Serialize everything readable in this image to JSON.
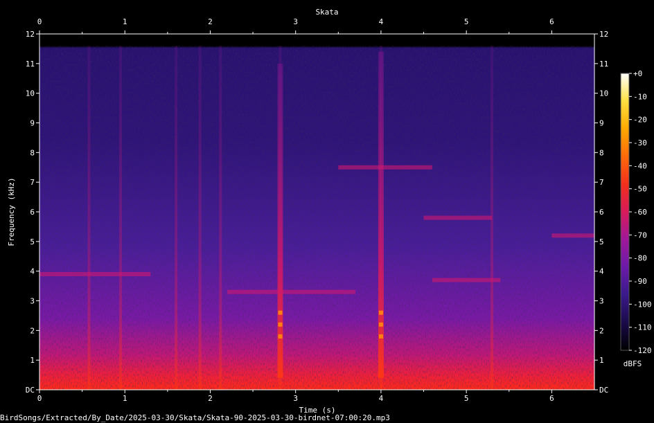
{
  "chart_data": {
    "type": "heatmap",
    "title": "Skata",
    "xlabel": "Time (s)",
    "ylabel": "Frequency (kHz)",
    "xlim": [
      0,
      6.5
    ],
    "ylim": [
      0,
      12
    ],
    "x_ticks": [
      "0",
      "1",
      "2",
      "3",
      "4",
      "5",
      "6"
    ],
    "y_ticks": [
      "DC",
      "1",
      "2",
      "3",
      "4",
      "5",
      "6",
      "7",
      "8",
      "9",
      "10",
      "11",
      "12"
    ],
    "colorbar": {
      "label": "dBFS",
      "range": [
        -120,
        0
      ],
      "ticks": [
        "+0",
        "-10",
        "-20",
        "-30",
        "-40",
        "-50",
        "-60",
        "-70",
        "-80",
        "-90",
        "-100",
        "-110",
        "-120"
      ],
      "colors": [
        "#000000",
        "#1a0a4a",
        "#3a1a8a",
        "#6a1aa8",
        "#a0189a",
        "#d81a5a",
        "#f2301c",
        "#ff6a0a",
        "#ffa800",
        "#ffe040",
        "#ffffff"
      ]
    },
    "content_cutoff_khz": 11.6,
    "vertical_bursts_s": [
      0.58,
      0.95,
      1.6,
      1.88,
      2.12,
      2.82,
      4.0,
      5.3
    ],
    "strong_calls": [
      {
        "t": 2.82,
        "f_lo": 0.4,
        "f_hi": 11.0
      },
      {
        "t": 4.0,
        "f_lo": 0.4,
        "f_hi": 11.4
      }
    ],
    "harmonic_bands": [
      {
        "t0": 0.0,
        "t1": 1.3,
        "f": 3.9
      },
      {
        "t0": 2.2,
        "t1": 3.7,
        "f": 3.3
      },
      {
        "t0": 3.5,
        "t1": 4.6,
        "f": 7.5
      },
      {
        "t0": 4.5,
        "t1": 5.3,
        "f": 5.8
      },
      {
        "t0": 4.6,
        "t1": 5.4,
        "f": 3.7
      },
      {
        "t0": 6.0,
        "t1": 6.5,
        "f": 5.2
      }
    ]
  },
  "footer": {
    "filepath": "BirdSongs/Extracted/By_Date/2025-03-30/Skata/Skata-90-2025-03-30-birdnet-07:00:20.mp3"
  }
}
